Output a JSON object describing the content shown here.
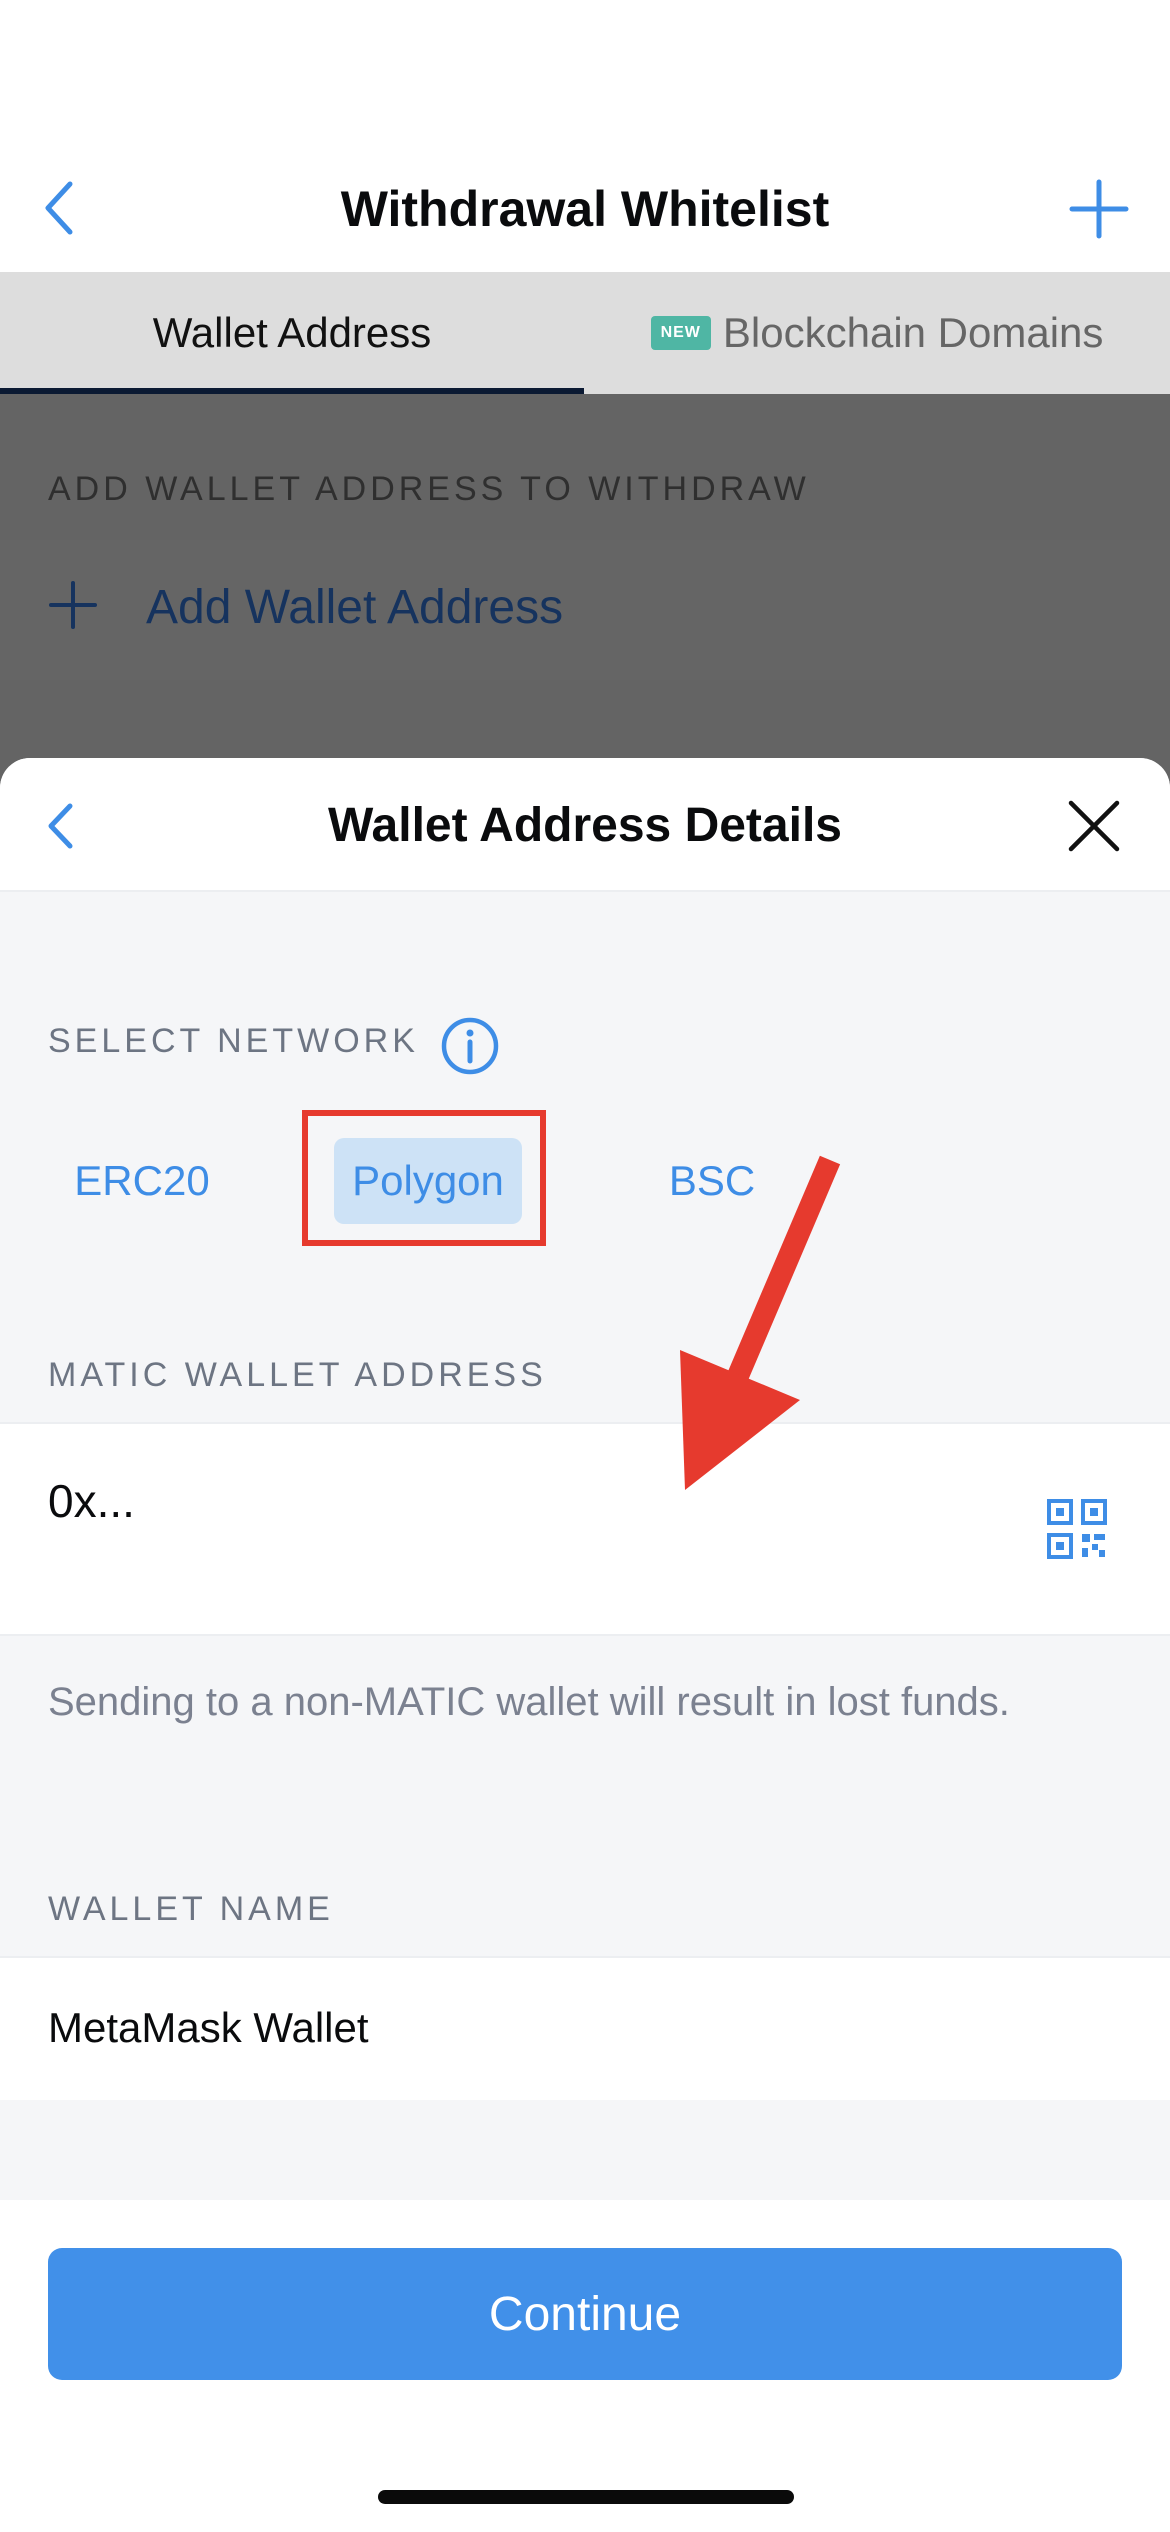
{
  "nav": {
    "title": "Withdrawal Whitelist"
  },
  "tabs": {
    "wallet_address": "Wallet Address",
    "new_badge": "NEW",
    "blockchain_domains": "Blockchain Domains"
  },
  "background": {
    "section_label": "ADD WALLET ADDRESS TO WITHDRAW",
    "add_wallet_label": "Add Wallet Address"
  },
  "sheet": {
    "title": "Wallet Address Details",
    "select_network_label": "SELECT NETWORK",
    "networks": [
      "ERC20",
      "Polygon",
      "BSC"
    ],
    "selected_network": "Polygon",
    "address_label": "MATIC WALLET ADDRESS",
    "address_placeholder": "0x...",
    "warning": "Sending to a non-MATIC wallet will result in lost funds.",
    "wallet_name_label": "WALLET NAME",
    "wallet_name_value": "MetaMask Wallet",
    "continue_label": "Continue"
  },
  "colors": {
    "accent": "#4190e9",
    "chip_selected_bg": "#cde2f6",
    "highlight_red": "#e63a2e",
    "new_badge": "#4fb6a4"
  }
}
